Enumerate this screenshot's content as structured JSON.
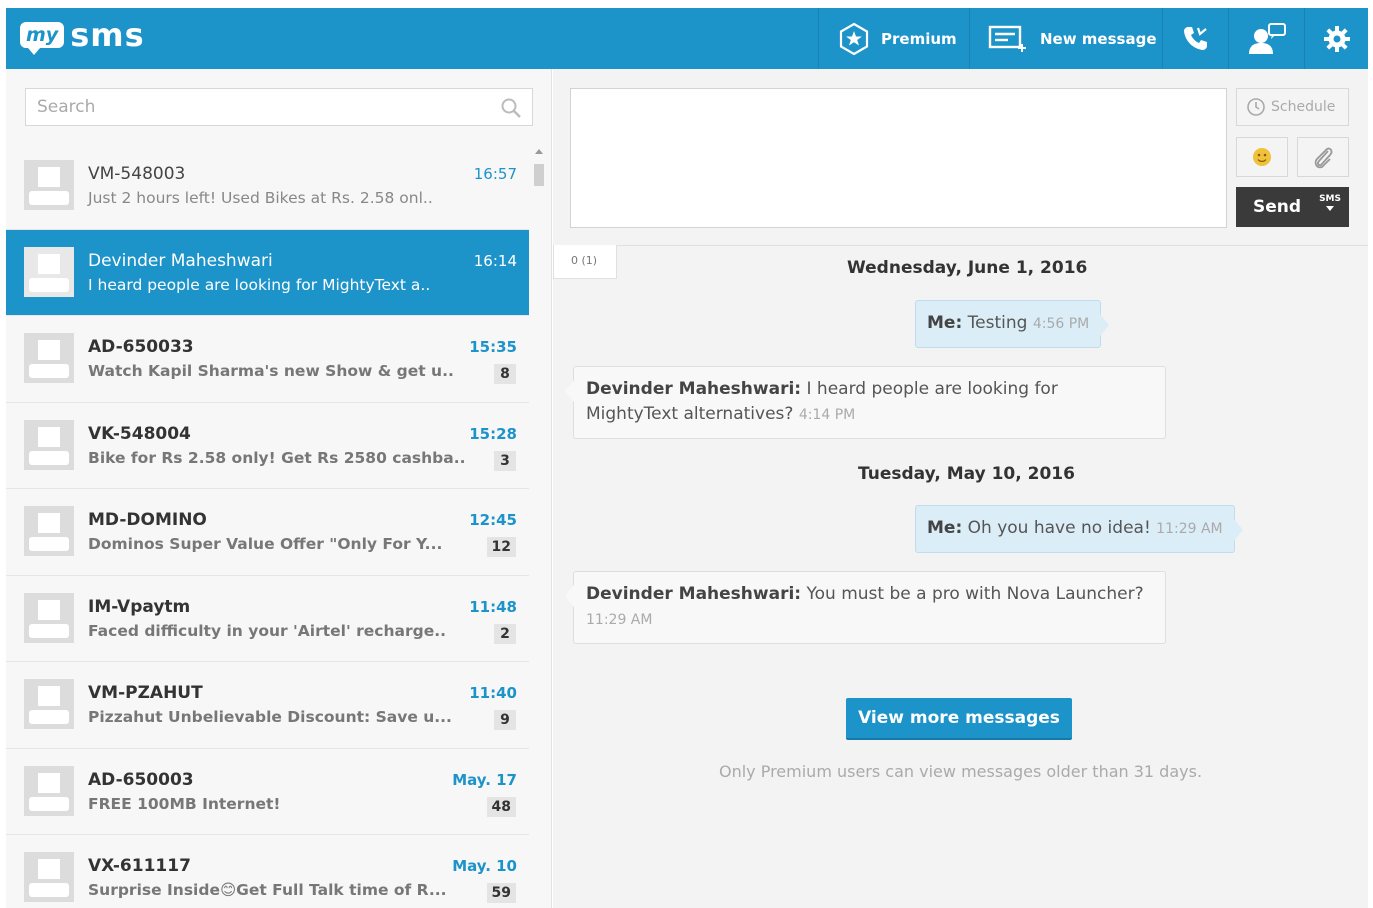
{
  "header": {
    "logo_badge": "my",
    "logo_text": "sms",
    "premium_label": "Premium",
    "new_message_label": "New message",
    "icons": [
      "premium-star-icon",
      "new-message-icon",
      "call-icon",
      "contacts-icon",
      "gear-icon"
    ]
  },
  "search": {
    "placeholder": "Search"
  },
  "conversations": [
    {
      "name": "VM-548003",
      "snippet": "Just 2 hours left! Used Bikes at Rs. 2.58 onl..",
      "time": "16:57",
      "badge": "",
      "unread": false,
      "selected": false
    },
    {
      "name": "Devinder Maheshwari",
      "snippet": "I heard people are looking for MightyText a..",
      "time": "16:14",
      "badge": "",
      "unread": false,
      "selected": true
    },
    {
      "name": "AD-650033",
      "snippet": "Watch Kapil Sharma's new Show & get u..",
      "time": "15:35",
      "badge": "8",
      "unread": true,
      "selected": false
    },
    {
      "name": "VK-548004",
      "snippet": "Bike for Rs 2.58 only! Get Rs 2580 cashba..",
      "time": "15:28",
      "badge": "3",
      "unread": true,
      "selected": false
    },
    {
      "name": "MD-DOMINO",
      "snippet": "Dominos Super Value Offer \"Only For Y...",
      "time": "12:45",
      "badge": "12",
      "unread": true,
      "selected": false
    },
    {
      "name": "IM-Vpaytm",
      "snippet": "Faced difficulty in your 'Airtel' recharge..",
      "time": "11:48",
      "badge": "2",
      "unread": true,
      "selected": false
    },
    {
      "name": "VM-PZAHUT",
      "snippet": "Pizzahut Unbelievable Discount: Save u...",
      "time": "11:40",
      "badge": "9",
      "unread": true,
      "selected": false
    },
    {
      "name": "AD-650003",
      "snippet": "FREE 100MB Internet!",
      "time": "May. 17",
      "badge": "48",
      "unread": true,
      "selected": false
    },
    {
      "name": "VX-611117",
      "snippet": "Surprise Inside😊Get Full Talk time of R...",
      "time": "May. 10",
      "badge": "59",
      "unread": true,
      "selected": false
    }
  ],
  "composer": {
    "schedule_label": "Schedule",
    "send_label": "Send",
    "send_type": "SMS",
    "char_count": "0 (1)"
  },
  "thread": {
    "dates": [
      "Wednesday, June 1, 2016",
      "Tuesday, May 10, 2016"
    ],
    "messages": [
      {
        "sender": "Me:",
        "text": "Testing",
        "time": "4:56 PM",
        "direction": "out"
      },
      {
        "sender": "Devinder Maheshwari:",
        "text": "I heard people are looking for MightyText alternatives?",
        "time": "4:14 PM",
        "direction": "in"
      },
      {
        "sender": "Me:",
        "text": "Oh you have no idea!",
        "time": "11:29 AM",
        "direction": "out"
      },
      {
        "sender": "Devinder Maheshwari:",
        "text": "You must be a pro with Nova Launcher?",
        "time": "11:29 AM",
        "direction": "in"
      }
    ],
    "view_more_label": "View more messages",
    "premium_note": "Only Premium users can view messages older than 31 days."
  },
  "colors": {
    "brand": "#1c93c9",
    "send": "#3a3a3a",
    "bubble_out": "#dbeef8",
    "bubble_in": "#f8f8f8"
  }
}
